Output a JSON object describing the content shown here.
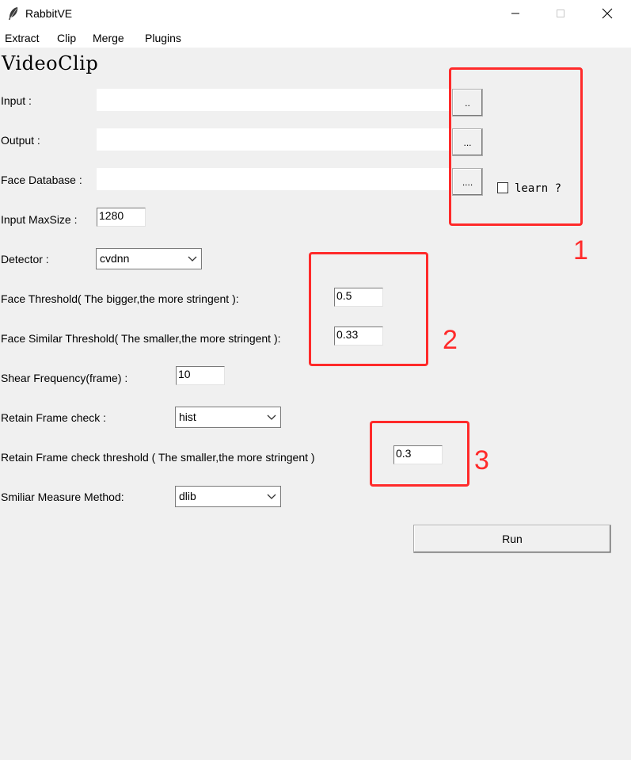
{
  "window": {
    "title": "RabbitVE",
    "controls": {
      "minimize_icon": "minimize-icon",
      "maximize_icon": "maximize-icon",
      "close_icon": "close-icon"
    }
  },
  "menu": [
    {
      "label": "Extract"
    },
    {
      "label": "Clip"
    },
    {
      "label": "Merge"
    },
    {
      "label": "Plugins"
    }
  ],
  "page": {
    "heading": "VideoClip",
    "input": {
      "label": "Input :",
      "value": "",
      "browse_label": ".."
    },
    "output": {
      "label": "Output :",
      "value": "",
      "browse_label": "..."
    },
    "face_db": {
      "label": "Face Database :",
      "value": "",
      "browse_label": "....",
      "learn_label": "learn ?",
      "learn_checked": false
    },
    "max_size": {
      "label": "Input MaxSize :",
      "value": "1280"
    },
    "detector": {
      "label": "Detector :",
      "value": "cvdnn"
    },
    "face_threshold": {
      "label": "Face Threshold( The bigger,the more stringent ):",
      "value": "0.5"
    },
    "face_similar": {
      "label": "Face Similar Threshold( The smaller,the more stringent ):",
      "value": "0.33"
    },
    "shear_freq": {
      "label": "Shear Frequency(frame) :",
      "value": "10"
    },
    "retain_check": {
      "label": "Retain Frame check :",
      "value": "hist"
    },
    "retain_threshold": {
      "label": "Retain Frame check threshold ( The smaller,the more stringent )",
      "value": "0.3"
    },
    "similar_method": {
      "label": "Smiliar Measure Method:",
      "value": "dlib"
    },
    "run_label": "Run"
  },
  "annotations": {
    "color": "#ff2a2a",
    "labels": [
      "1",
      "2",
      "3"
    ]
  }
}
